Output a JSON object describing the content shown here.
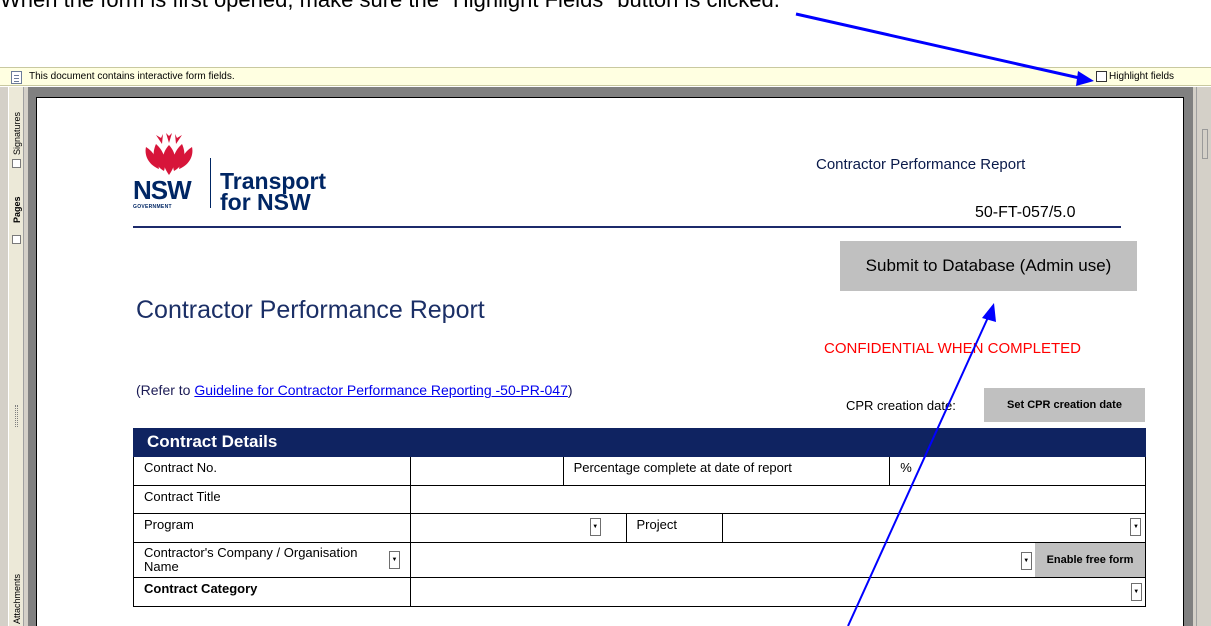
{
  "instruction": "When the form is first opened, make sure the \"Highlight Fields\" button is clicked.",
  "notice_bar": {
    "message": "This document contains interactive form fields.",
    "highlight_label": "Highlight fields",
    "highlight_checked": false
  },
  "nav_tabs": {
    "signatures": "Signatures",
    "pages": "Pages",
    "attachments": "Attachments"
  },
  "logo": {
    "mark": "NSW",
    "government": "GOVERNMENT",
    "line1": "Transport",
    "line2": "for NSW"
  },
  "header": {
    "report_title": "Contractor Performance Report",
    "doc_number": "50-FT-057/5.0",
    "submit_button": "Submit to Database (Admin use)"
  },
  "page_title": "Contractor Performance Report",
  "confidential": "CONFIDENTIAL WHEN COMPLETED",
  "refer": {
    "prefix": "(Refer to ",
    "link": "Guideline for Contractor Performance Reporting -50-PR-047",
    "suffix": ")"
  },
  "cpr": {
    "label": "CPR creation date:",
    "button": "Set CPR creation date"
  },
  "section": {
    "title": "Contract Details"
  },
  "rows": {
    "contract_no": "Contract No.",
    "pct_label": "Percentage complete at date of report",
    "pct_unit": "%",
    "contract_title": "Contract Title",
    "program": "Program",
    "project": "Project",
    "company": "Contractor's Company / Organisation Name",
    "enable_free_form": "Enable free form",
    "category": "Contract Category"
  },
  "colors": {
    "navy": "#0f2361",
    "accent_red": "#ff0000",
    "arrow_blue": "#0000ff",
    "button_gray": "#c0c0c0"
  }
}
